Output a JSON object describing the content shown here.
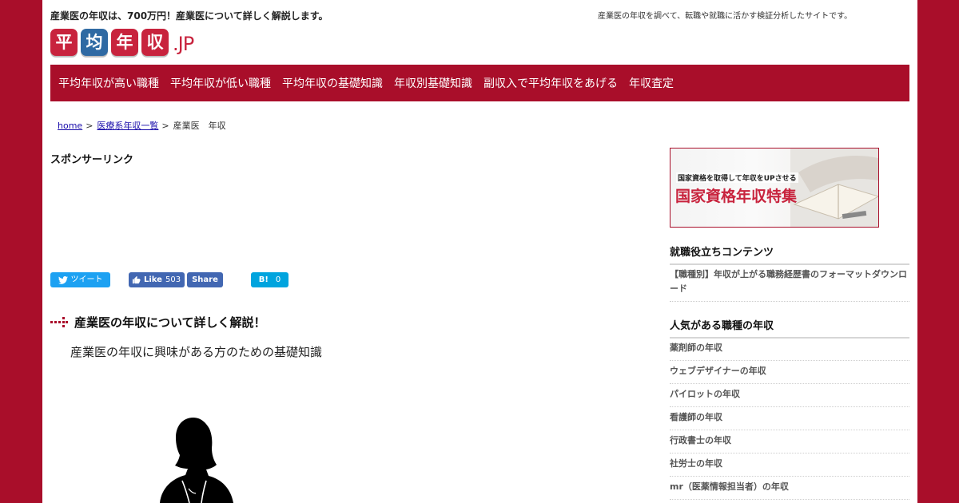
{
  "header": {
    "tagline": "産業医の年収は、700万円！産業医について詳しく解説します。",
    "description": "産業医の年収を調べて、転職や就職に活かす検証分析したサイトです。",
    "logo": {
      "blocks": [
        "平",
        "均",
        "年",
        "収"
      ],
      "suffix": ".JP"
    }
  },
  "nav": {
    "items": [
      "平均年収が高い職種",
      "平均年収が低い職種",
      "平均年収の基礎知識",
      "年収別基礎知識",
      "副収入で平均年収をあげる",
      "年収査定"
    ]
  },
  "breadcrumb": {
    "home": "home",
    "sep1": ">",
    "category": "医療系年収一覧",
    "sep2": ">",
    "current": "産業医　年収"
  },
  "main": {
    "sponsor": "スポンサーリンク",
    "share": {
      "tweet": "ツイート",
      "like": "Like",
      "like_count": "503",
      "fb_share": "Share",
      "hatena": "B!",
      "hatena_count": "0"
    },
    "article_title": "産業医の年収について詳しく解説！",
    "subtitle": "産業医の年収に興味がある方のための基礎知識"
  },
  "sidebar": {
    "banner": {
      "kicker": "国家資格を取得して年収をUPさせる",
      "title": "国家資格年収特集"
    },
    "section1": {
      "heading": "就職役立ちコンテンツ",
      "text": "【職種別】年収が上がる職務経歴書のフォーマットダウンロード"
    },
    "section2": {
      "heading": "人気がある職種の年収",
      "items": [
        "薬剤師の年収",
        "ウェブデザイナーの年収",
        "パイロットの年収",
        "看護師の年収",
        "行政書士の年収",
        "社労士の年収",
        "mr（医薬情報担当者）の年収"
      ]
    }
  },
  "colors": {
    "brand": "#a90e2a",
    "logo_red": "#c8233d",
    "logo_blue": "#2f6aa3",
    "twitter": "#1da1f2",
    "facebook": "#4267b2",
    "hatena": "#00a4de"
  }
}
